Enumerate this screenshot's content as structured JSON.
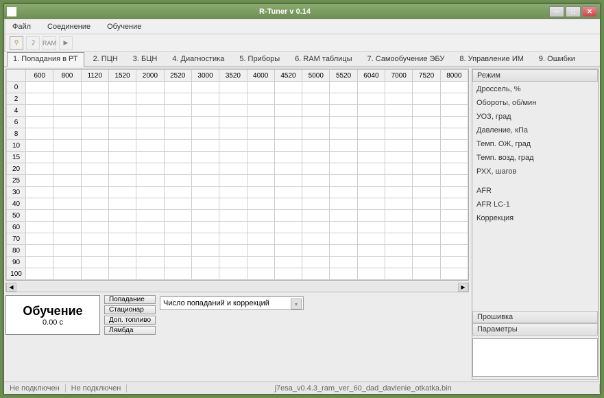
{
  "window": {
    "title": "R-Tuner v 0.14"
  },
  "menu": {
    "file": "Файл",
    "conn": "Соединение",
    "learn": "Обучение"
  },
  "toolbar": {
    "ram": "RAM"
  },
  "tabs": [
    "1. Попадания в РТ",
    "2. ПЦН",
    "3. БЦН",
    "4. Диагностика",
    "5. Приборы",
    "6. RAM таблицы",
    "7. Самообучение ЭБУ",
    "8. Управление ИМ",
    "9. Ошибки"
  ],
  "grid": {
    "cols": [
      "600",
      "800",
      "1120",
      "1520",
      "2000",
      "2520",
      "3000",
      "3520",
      "4000",
      "4520",
      "5000",
      "5520",
      "6040",
      "7000",
      "7520",
      "8000"
    ],
    "rows": [
      "0",
      "2",
      "4",
      "6",
      "8",
      "10",
      "15",
      "20",
      "25",
      "30",
      "40",
      "50",
      "60",
      "70",
      "80",
      "90",
      "100"
    ]
  },
  "learn": {
    "title": "Обучение",
    "time": "0.00 c"
  },
  "buttons": {
    "hit": "Попадание",
    "stat": "Стационар",
    "fuel": "Доп. топливо",
    "lambda": "Лямбда"
  },
  "dropdown": {
    "value": "Число попаданий и коррекций"
  },
  "side": {
    "mode": "Режим",
    "params": [
      "Дроссель, %",
      "Обороты, об/мин",
      "УОЗ, град",
      "Давление, кПа",
      "Темп. ОЖ, град",
      "Темп. возд, град",
      "РХХ, шагов",
      "",
      "AFR",
      "AFR LC-1",
      "Коррекция"
    ],
    "fw": "Прошивка",
    "prm": "Параметры"
  },
  "status": {
    "c1": "Не подключен",
    "c2": "Не подключен",
    "fn": "j7esa_v0.4.3_ram_ver_60_dad_davlenie_otkatka.bin"
  }
}
